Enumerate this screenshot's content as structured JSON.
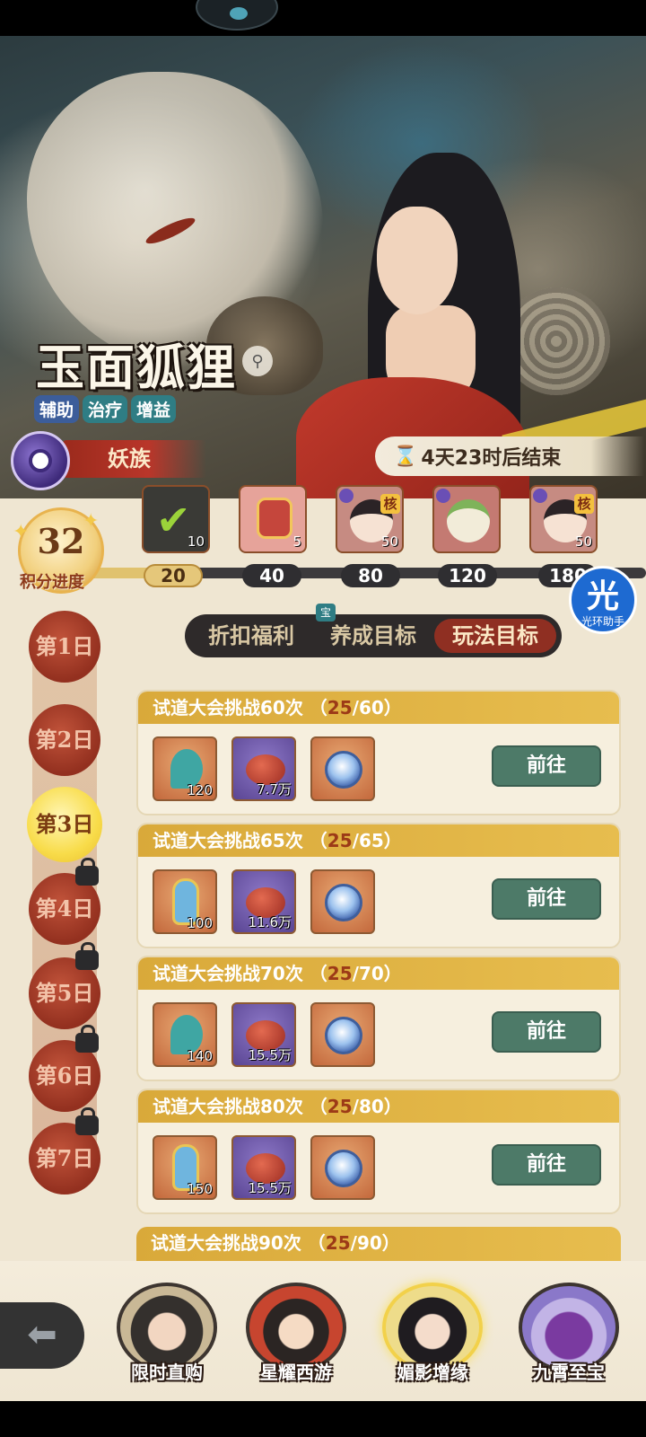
{
  "banner": {
    "hero_name": "玉面狐狸",
    "tags": [
      "辅助",
      "治疗",
      "增益"
    ],
    "faction": "妖族",
    "countdown": "4天23时后结束"
  },
  "score": {
    "value": "32",
    "label": "积分进度"
  },
  "progress": {
    "current": 32,
    "milestones": [
      "20",
      "40",
      "80",
      "120",
      "180"
    ],
    "rewards": [
      {
        "qty": "10",
        "claimed": true
      },
      {
        "qty": "5"
      },
      {
        "qty": "50",
        "tag": "核"
      },
      {
        "qty": ""
      },
      {
        "qty": "50",
        "tag": "核"
      }
    ]
  },
  "helper": {
    "glyph": "光",
    "label": "光环助手"
  },
  "tabs": {
    "items": [
      "折扣福利",
      "养成目标",
      "玩法目标"
    ],
    "active": 2,
    "badge": "宝"
  },
  "days": [
    "第1日",
    "第2日",
    "第3日",
    "第4日",
    "第5日",
    "第6日",
    "第7日"
  ],
  "active_day": 2,
  "tasks": [
    {
      "prefix": "试道大会挑战60次 （",
      "cur": "25",
      "suffix": "/60）",
      "items": [
        {
          "qty": "120"
        },
        {
          "qty": "7.7万"
        },
        {
          "qty": ""
        }
      ],
      "button": "前往"
    },
    {
      "prefix": "试道大会挑战65次 （",
      "cur": "25",
      "suffix": "/65）",
      "items": [
        {
          "qty": "100"
        },
        {
          "qty": "11.6万"
        },
        {
          "qty": ""
        }
      ],
      "button": "前往"
    },
    {
      "prefix": "试道大会挑战70次 （",
      "cur": "25",
      "suffix": "/70）",
      "items": [
        {
          "qty": "140"
        },
        {
          "qty": "15.5万"
        },
        {
          "qty": ""
        }
      ],
      "button": "前往"
    },
    {
      "prefix": "试道大会挑战80次 （",
      "cur": "25",
      "suffix": "/80）",
      "items": [
        {
          "qty": "150"
        },
        {
          "qty": "15.5万"
        },
        {
          "qty": ""
        }
      ],
      "button": "前往"
    },
    {
      "prefix": "试道大会挑战90次 （",
      "cur": "25",
      "suffix": "/90）"
    }
  ],
  "bottom_nav": {
    "back_icon": "back-arrow-icon",
    "items": [
      "限时直购",
      "星耀西游",
      "媚影增缘",
      "九霄至宝"
    ],
    "active": 2
  },
  "colors": {
    "accent_gold": "#e7bd4e",
    "button_green": "#4d7a68",
    "active_tab": "#8f2f22"
  }
}
